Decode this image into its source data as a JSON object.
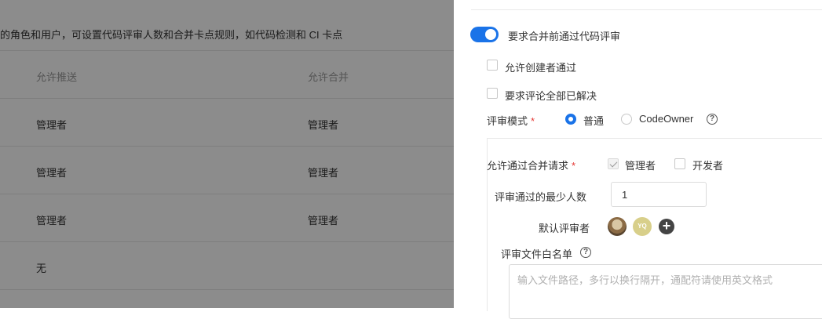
{
  "background": {
    "description": "的角色和用户，可设置代码评审人数和合并卡点规则，如代码检测和 CI 卡点",
    "headers": {
      "push": "允许推送",
      "merge": "允许合并"
    },
    "rows": [
      {
        "push": "管理者",
        "merge": "管理者"
      },
      {
        "push": "管理者",
        "merge": "管理者"
      },
      {
        "push": "管理者",
        "merge": "管理者"
      },
      {
        "push": "无",
        "merge": ""
      }
    ]
  },
  "panel": {
    "require_review": {
      "label": "要求合并前通过代码评审",
      "enabled": true
    },
    "allow_creator": {
      "label": "允许创建者通过",
      "checked": false
    },
    "require_resolved": {
      "label": "要求评论全部已解决",
      "checked": false
    },
    "review_mode": {
      "label": "评审模式",
      "required_mark": "*",
      "options": [
        "普通",
        "CodeOwner"
      ],
      "selected": "普通"
    },
    "allow_merge_request": {
      "label": "允许通过合并请求",
      "required_mark": "*",
      "options": [
        {
          "label": "管理者",
          "checked": true,
          "disabled": true
        },
        {
          "label": "开发者",
          "checked": false
        }
      ]
    },
    "min_reviewers": {
      "label": "评审通过的最少人数",
      "value": "1"
    },
    "default_reviewers": {
      "label": "默认评审者",
      "avatar2_initials": "YQ",
      "add_symbol": "+"
    },
    "whitelist": {
      "label": "评审文件白名单",
      "placeholder": "输入文件路径，多行以换行隔开，通配符请使用英文格式"
    },
    "help_symbol": "?",
    "accent_color": "#1a73e8"
  }
}
